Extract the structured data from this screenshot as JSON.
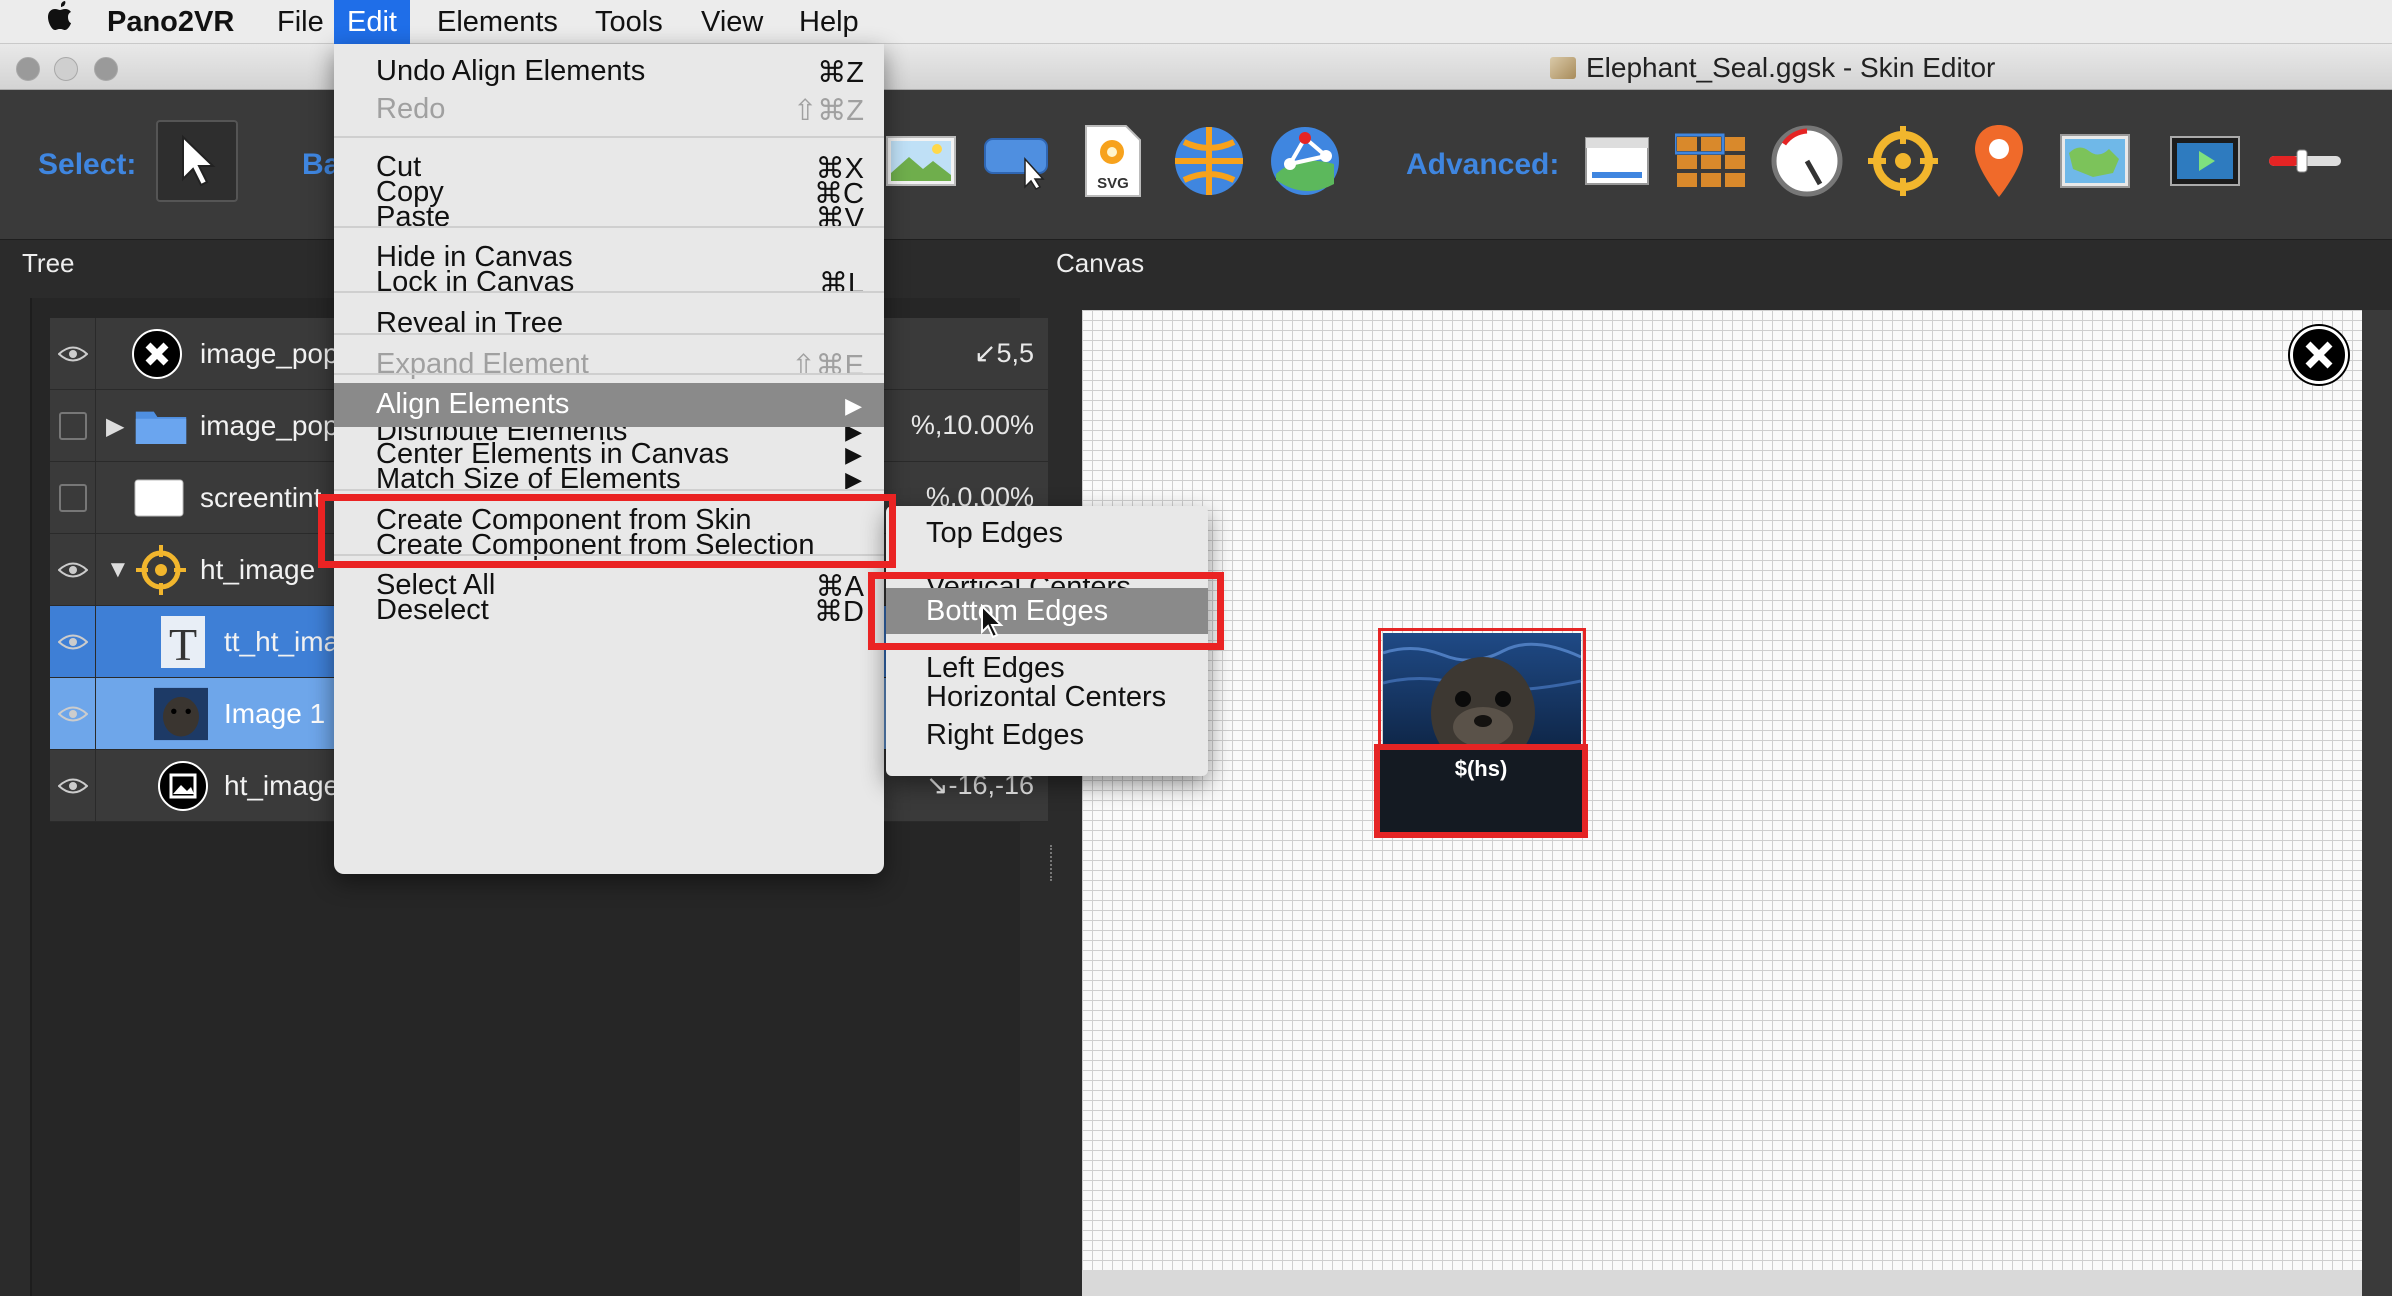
{
  "menubar": {
    "app_name": "Pano2VR",
    "items": [
      "File",
      "Edit",
      "Elements",
      "Tools",
      "View",
      "Help"
    ],
    "active_item": "Edit"
  },
  "window": {
    "title": "Elephant_Seal.ggsk - Skin Editor"
  },
  "toolbar": {
    "select_label": "Select:",
    "basic_label": "Ba",
    "advanced_label": "Advanced:",
    "basic_tools": [
      "image-tool-icon",
      "button-tool-icon",
      "svg-tool-icon",
      "hotspot-globe-icon",
      "map-node-icon"
    ],
    "advanced_tools": [
      "rectangle-tool-icon",
      "grid-tool-icon",
      "dial-tool-icon",
      "compass-icon",
      "map-pin-icon",
      "map-image-icon",
      "video-tool-icon",
      "slider-tool-icon"
    ],
    "svg_badge": "SVG"
  },
  "tree": {
    "title": "Tree",
    "rows": [
      {
        "name": "image_popu",
        "value": "↙5,5",
        "visible": true,
        "icon": "close-circle-icon"
      },
      {
        "name": "image_popu",
        "value": "%,10.00%",
        "visible": false,
        "icon": "folder-icon",
        "expandable": true
      },
      {
        "name": "screentint",
        "value": "%,0.00%",
        "visible": false,
        "icon": "rectangle-icon"
      },
      {
        "name": "ht_image",
        "value": "",
        "visible": true,
        "icon": "crosshair-icon",
        "expanded": true
      },
      {
        "name": "tt_ht_ima",
        "value": "",
        "visible": true,
        "icon": "text-icon"
      },
      {
        "name": "Image 1",
        "value": "",
        "visible": true,
        "icon": "seal-thumbnail-icon"
      },
      {
        "name": "ht_image",
        "value": "↘-16,-16",
        "visible": true,
        "icon": "picture-icon"
      }
    ]
  },
  "canvas": {
    "title": "Canvas",
    "text_element": "$(hs)"
  },
  "edit_menu": {
    "groups": [
      [
        {
          "label": "Undo Align Elements",
          "shortcut": "⌘Z"
        },
        {
          "label": "Redo",
          "shortcut": "⇧⌘Z",
          "disabled": true
        }
      ],
      [
        {
          "label": "Cut",
          "shortcut": "⌘X"
        },
        {
          "label": "Copy",
          "shortcut": "⌘C"
        },
        {
          "label": "Paste",
          "shortcut": "⌘V"
        }
      ],
      [
        {
          "label": "Hide in Canvas",
          "shortcut": ""
        },
        {
          "label": "Lock in Canvas",
          "shortcut": "⌘L"
        }
      ],
      [
        {
          "label": "Reveal in Tree",
          "shortcut": ""
        }
      ],
      [
        {
          "label": "Expand Element",
          "shortcut": "⇧⌘E",
          "disabled": true
        }
      ],
      [
        {
          "label": "Align Elements",
          "submenu": true
        },
        {
          "label": "Distribute Elements",
          "submenu": true
        },
        {
          "label": "Center Elements in Canvas",
          "submenu": true
        },
        {
          "label": "Match Size of Elements",
          "submenu": true
        }
      ],
      [
        {
          "label": "Create Component from Skin"
        },
        {
          "label": "Create Component from Selection"
        }
      ],
      [
        {
          "label": "Select All",
          "shortcut": "⌘A"
        },
        {
          "label": "Deselect",
          "shortcut": "⌘D"
        }
      ]
    ],
    "highlighted": "Align Elements"
  },
  "align_submenu": {
    "items": [
      "Top Edges",
      "Vertical Centers",
      "Bottom Edges",
      "Left Edges",
      "Horizontal Centers",
      "Right Edges"
    ],
    "highlighted": "Bottom Edges"
  },
  "colors": {
    "accent_blue": "#3f86e0",
    "selection_blue": "#3e7fd6",
    "annotation_red": "#ea2323",
    "menu_highlight": "#8a8a8a"
  }
}
